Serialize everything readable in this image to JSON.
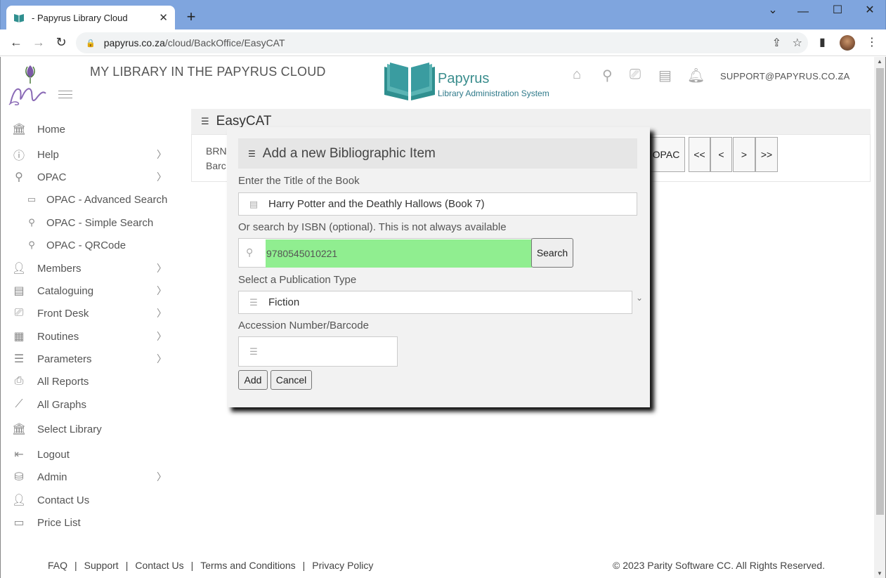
{
  "browser": {
    "tab_title": "- Papyrus Library Cloud",
    "tab_close": "✕",
    "new_tab": "+",
    "url_domain": "papyrus.co.za",
    "url_path": "/cloud/BackOffice/EasyCAT"
  },
  "header": {
    "app_title": "MY LIBRARY IN THE PAPYRUS CLOUD",
    "logo_name": "Papyrus",
    "logo_subtitle": "Library Administration System",
    "user": "SUPPORT@PAPYRUS.CO.ZA"
  },
  "sidebar": {
    "items": [
      {
        "label": "Home",
        "icon": "bank-icon"
      },
      {
        "label": "Help",
        "icon": "info-icon"
      },
      {
        "label": "OPAC",
        "icon": "search-icon"
      },
      {
        "label": "OPAC - Advanced Search",
        "icon": "monitor-icon"
      },
      {
        "label": "OPAC - Simple Search",
        "icon": "search-icon"
      },
      {
        "label": "OPAC - QRCode",
        "icon": "search-icon"
      },
      {
        "label": "Members",
        "icon": "users-icon"
      },
      {
        "label": "Cataloguing",
        "icon": "book-icon"
      },
      {
        "label": "Front Desk",
        "icon": "desk-icon"
      },
      {
        "label": "Routines",
        "icon": "calendar-icon"
      },
      {
        "label": "Parameters",
        "icon": "list-icon"
      },
      {
        "label": "All Reports",
        "icon": "printer-icon"
      },
      {
        "label": "All Graphs",
        "icon": "graph-icon"
      },
      {
        "label": "Select Library",
        "icon": "bank-icon"
      },
      {
        "label": "Logout",
        "icon": "logout-icon"
      },
      {
        "label": "Admin",
        "icon": "database-icon"
      },
      {
        "label": "Contact Us",
        "icon": "user-icon"
      },
      {
        "label": "Price List",
        "icon": "wallet-icon"
      }
    ]
  },
  "panel": {
    "title": "EasyCAT",
    "line1": "BRN,",
    "line2": "Barc",
    "opac_btn": "OPAC",
    "first_btn": "<<",
    "prev_btn": "<",
    "next_btn": ">",
    "last_btn": ">>"
  },
  "modal": {
    "title": "Add a new Bibliographic Item",
    "title_label": "Enter the Title of the Book",
    "title_value": "Harry Potter and the Deathly Hallows (Book 7)",
    "isbn_label": "Or search by ISBN (optional). This is not always available",
    "isbn_value": "9780545010221",
    "isbn_highlight_color": "#90ee90",
    "search_btn": "Search",
    "pubtype_label": "Select a Publication Type",
    "pubtype_value": "Fiction",
    "accession_label": "Accession Number/Barcode",
    "accession_value": "",
    "add_btn": "Add",
    "cancel_btn": "Cancel"
  },
  "footer": {
    "links": [
      "FAQ",
      "Support",
      "Contact Us",
      "Terms and Conditions",
      "Privacy Policy"
    ],
    "copyright": "© 2023 Parity Software CC. All Rights Reserved."
  }
}
